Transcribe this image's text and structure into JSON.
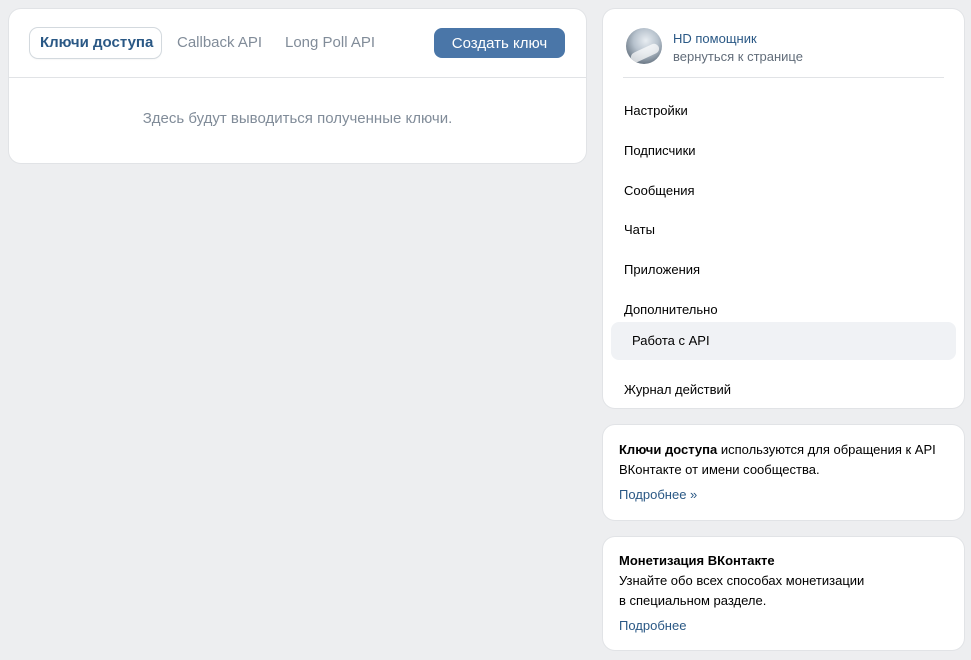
{
  "main": {
    "tabs": [
      {
        "label": "Ключи доступа",
        "active": true
      },
      {
        "label": "Callback API",
        "active": false
      },
      {
        "label": "Long Poll API",
        "active": false
      }
    ],
    "create_button": "Создать ключ",
    "empty_text": "Здесь будут выводиться полученные ключи."
  },
  "sidebar": {
    "group_name": "HD помощник",
    "back_link": "вернуться к странице",
    "items": [
      {
        "label": "Настройки",
        "selected": false
      },
      {
        "label": "Подписчики",
        "selected": false
      },
      {
        "label": "Сообщения",
        "selected": false
      },
      {
        "label": "Чаты",
        "selected": false
      },
      {
        "label": "Приложения",
        "selected": false
      },
      {
        "label": "Дополнительно",
        "selected": false
      },
      {
        "label": "Работа с API",
        "selected": true
      },
      {
        "label": "Журнал действий",
        "selected": false
      }
    ]
  },
  "info": {
    "bold": "Ключи доступа",
    "text": " используются для обращения к API ВКонтакте от имени сообщества.",
    "link": "Подробнее »"
  },
  "monetization": {
    "title": "Монетизация ВКонтакте",
    "line1": "Узнайте обо всех способах монетизации",
    "line2": "в специальном разделе.",
    "link": "Подробнее"
  },
  "colors": {
    "accent": "#4a76a8",
    "link": "#2a5885",
    "muted": "#818c99",
    "background": "#edeef0"
  }
}
